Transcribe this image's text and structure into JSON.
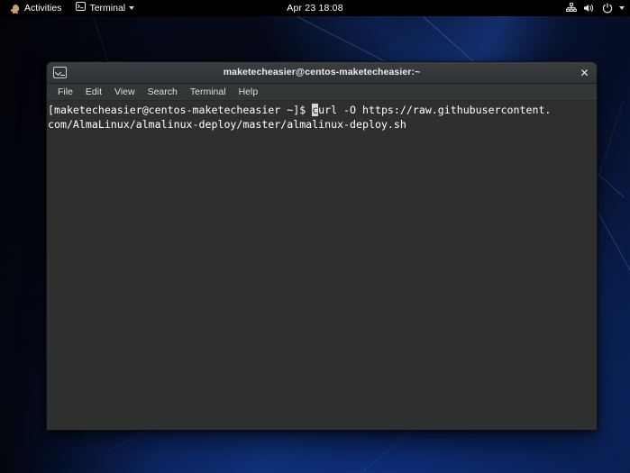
{
  "panel": {
    "activities_label": "Activities",
    "app_menu_label": "Terminal",
    "clock": "Apr 23  18:08",
    "tray": [
      {
        "name": "network-icon"
      },
      {
        "name": "volume-icon"
      },
      {
        "name": "power-icon"
      },
      {
        "name": "chevron-down-icon"
      }
    ]
  },
  "window": {
    "title": "maketecheasier@centos-maketecheasier:~",
    "close_label": "✕",
    "menubar": [
      {
        "label": "File"
      },
      {
        "label": "Edit"
      },
      {
        "label": "View"
      },
      {
        "label": "Search"
      },
      {
        "label": "Terminal"
      },
      {
        "label": "Help"
      }
    ]
  },
  "terminal": {
    "prompt": "[maketecheasier@centos-maketecheasier ~]$ ",
    "cursor_char": "c",
    "command_rest": "url -O https://raw.githubusercontent.",
    "line2": "com/AlmaLinux/almalinux-deploy/master/almalinux-deploy.sh"
  },
  "colors": {
    "panel_bg": "#000000",
    "titlebar_bg": "#33373a",
    "menubar_bg": "#323637",
    "terminal_bg": "#2e3030",
    "terminal_fg": "#ffffff",
    "wallpaper_blue": "#0b2a6b",
    "scrollbar_thumb": "#d4d4d4"
  }
}
